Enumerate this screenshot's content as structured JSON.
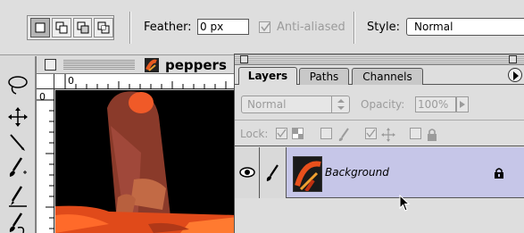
{
  "options_bar": {
    "selection_modes": [
      "new-selection",
      "add-to-selection",
      "subtract-from-selection",
      "intersect-selection"
    ],
    "feather_label": "Feather:",
    "feather_value": "0 px",
    "antialiased_label": "Anti-aliased",
    "antialiased_checked": true,
    "style_label": "Style:",
    "style_value": "Normal"
  },
  "document": {
    "title": "peppers",
    "ruler_zero": "0"
  },
  "layers_palette": {
    "tabs": [
      {
        "label": "Layers",
        "active": true
      },
      {
        "label": "Paths",
        "active": false
      },
      {
        "label": "Channels",
        "active": false
      }
    ],
    "blend_mode": "Normal",
    "opacity_label": "Opacity:",
    "opacity_value": "100%",
    "lock_label": "Lock:",
    "layers": [
      {
        "name": "Background",
        "visible": true,
        "locked": true
      }
    ]
  }
}
